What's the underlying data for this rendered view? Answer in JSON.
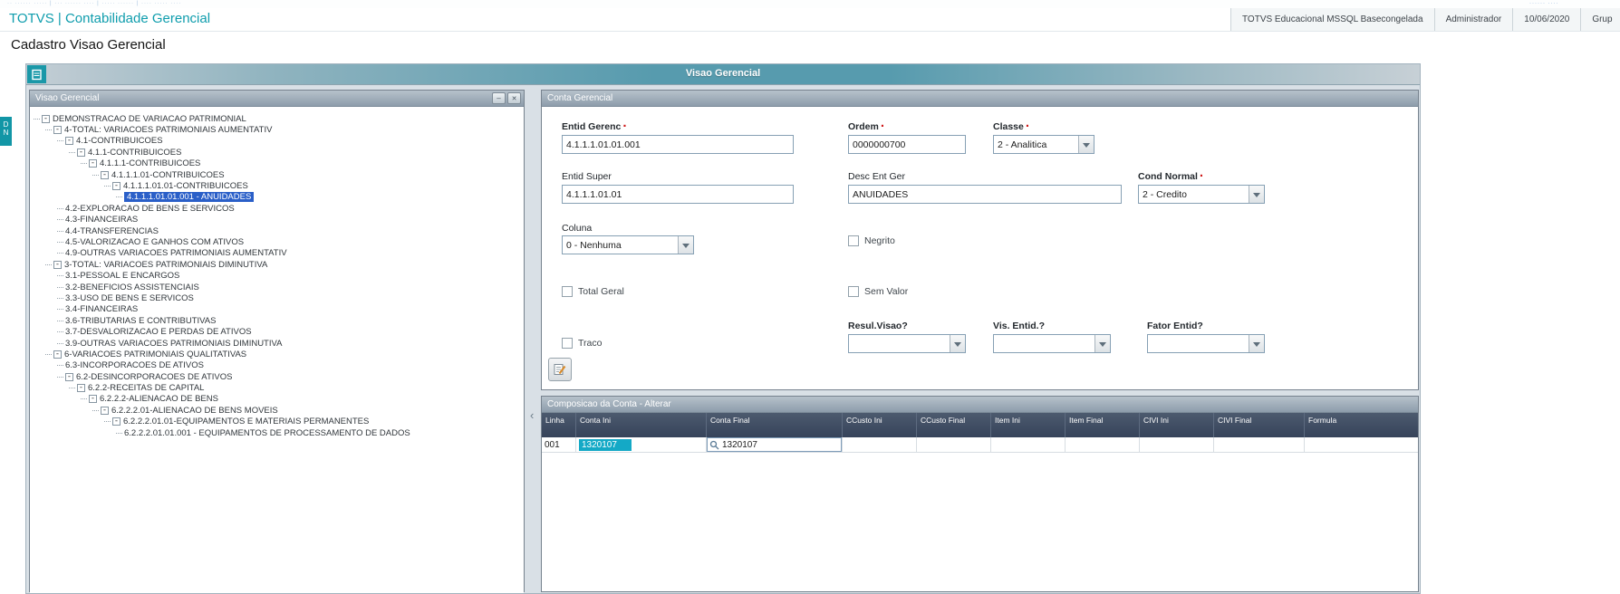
{
  "top_strip": {
    "left": "·· ······ ····· | ··· ······ ···· | ····· ······ | ···· ····· ····",
    "right": "······ ····"
  },
  "app_header": {
    "brand": "TOTVS | Contabilidade Gerencial",
    "environment": "TOTVS Educacional MSSQL Basecongelada",
    "user": "Administrador",
    "date": "10/06/2020",
    "group": "Grup"
  },
  "page_title": "Cadastro Visao Gerencial",
  "window": {
    "title": "Visao Gerencial"
  },
  "side_tab": "D\nN",
  "colors": {
    "brand_teal": "#0f9dad",
    "tree_selection": "#2a5fc8",
    "cell_highlight": "#14a9c6"
  },
  "tree_panel": {
    "title": "Visao Gerencial",
    "items": [
      {
        "level": 0,
        "label": "DEMONSTRACAO DE VARIACAO PATRIMONIAL",
        "expandable": true,
        "selected": false
      },
      {
        "level": 1,
        "label": "4-TOTAL: VARIACOES PATRIMONIAIS AUMENTATIV",
        "expandable": true,
        "selected": false
      },
      {
        "level": 2,
        "label": "4.1-CONTRIBUICOES",
        "expandable": true,
        "selected": false
      },
      {
        "level": 3,
        "label": "4.1.1-CONTRIBUICOES",
        "expandable": true,
        "selected": false
      },
      {
        "level": 4,
        "label": "4.1.1.1-CONTRIBUICOES",
        "expandable": true,
        "selected": false
      },
      {
        "level": 5,
        "label": "4.1.1.1.01-CONTRIBUICOES",
        "expandable": true,
        "selected": false
      },
      {
        "level": 6,
        "label": "4.1.1.1.01.01-CONTRIBUICOES",
        "expandable": true,
        "selected": false
      },
      {
        "level": 7,
        "label": "4.1.1.1.01.01.001 - ANUIDADES",
        "expandable": false,
        "selected": true
      },
      {
        "level": 2,
        "label": "4.2-EXPLORACAO DE BENS E SERVICOS",
        "expandable": false,
        "selected": false
      },
      {
        "level": 2,
        "label": "4.3-FINANCEIRAS",
        "expandable": false,
        "selected": false
      },
      {
        "level": 2,
        "label": "4.4-TRANSFERENCIAS",
        "expandable": false,
        "selected": false
      },
      {
        "level": 2,
        "label": "4.5-VALORIZACAO E GANHOS COM ATIVOS",
        "expandable": false,
        "selected": false
      },
      {
        "level": 2,
        "label": "4.9-OUTRAS VARIACOES PATRIMONIAIS AUMENTATIV",
        "expandable": false,
        "selected": false
      },
      {
        "level": 1,
        "label": "3-TOTAL: VARIACOES PATRIMONIAIS DIMINUTIVA",
        "expandable": true,
        "selected": false
      },
      {
        "level": 2,
        "label": "3.1-PESSOAL E ENCARGOS",
        "expandable": false,
        "selected": false
      },
      {
        "level": 2,
        "label": "3.2-BENEFICIOS ASSISTENCIAIS",
        "expandable": false,
        "selected": false
      },
      {
        "level": 2,
        "label": "3.3-USO DE BENS E SERVICOS",
        "expandable": false,
        "selected": false
      },
      {
        "level": 2,
        "label": "3.4-FINANCEIRAS",
        "expandable": false,
        "selected": false
      },
      {
        "level": 2,
        "label": "3.6-TRIBUTARIAS E CONTRIBUTIVAS",
        "expandable": false,
        "selected": false
      },
      {
        "level": 2,
        "label": "3.7-DESVALORIZACAO E PERDAS DE ATIVOS",
        "expandable": false,
        "selected": false
      },
      {
        "level": 2,
        "label": "3.9-OUTRAS VARIACOES PATRIMONIAIS DIMINUTIVA",
        "expandable": false,
        "selected": false
      },
      {
        "level": 1,
        "label": "6-VARIACOES PATRIMONIAIS QUALITATIVAS",
        "expandable": true,
        "selected": false
      },
      {
        "level": 2,
        "label": "6.3-INCORPORACOES DE ATIVOS",
        "expandable": false,
        "selected": false
      },
      {
        "level": 2,
        "label": "6.2-DESINCORPORACOES DE ATIVOS",
        "expandable": true,
        "selected": false
      },
      {
        "level": 3,
        "label": "6.2.2-RECEITAS DE CAPITAL",
        "expandable": true,
        "selected": false
      },
      {
        "level": 4,
        "label": "6.2.2.2-ALIENACAO DE BENS",
        "expandable": true,
        "selected": false
      },
      {
        "level": 5,
        "label": "6.2.2.2.01-ALIENACAO DE BENS MOVEIS",
        "expandable": true,
        "selected": false
      },
      {
        "level": 6,
        "label": "6.2.2.2.01.01-EQUIPAMENTOS E MATERIAIS PERMANENTES",
        "expandable": true,
        "selected": false
      },
      {
        "level": 7,
        "label": "6.2.2.2.01.01.001 - EQUIPAMENTOS DE PROCESSAMENTO DE DADOS",
        "expandable": false,
        "selected": false
      }
    ]
  },
  "form_panel": {
    "title": "Conta Gerencial",
    "fields": {
      "entid_gerenc": {
        "label": "Entid Gerenc",
        "required": true,
        "value": "4.1.1.1.01.01.001"
      },
      "ordem": {
        "label": "Ordem",
        "required": true,
        "value": "0000000700"
      },
      "classe": {
        "label": "Classe",
        "required": true,
        "value": "2 - Analitica"
      },
      "entid_super": {
        "label": "Entid Super",
        "required": false,
        "value": "4.1.1.1.01.01"
      },
      "desc_ent_ger": {
        "label": "Desc Ent Ger",
        "required": false,
        "value": "ANUIDADES"
      },
      "cond_normal": {
        "label": "Cond Normal",
        "required": true,
        "value": "2 - Credito"
      },
      "coluna": {
        "label": "Coluna",
        "required": false,
        "value": "0 - Nenhuma"
      },
      "negrito": {
        "label": "Negrito",
        "checked": false
      },
      "total_geral": {
        "label": "Total Geral",
        "checked": false
      },
      "sem_valor": {
        "label": "Sem Valor",
        "checked": false
      },
      "traco": {
        "label": "Traco",
        "checked": false
      },
      "resul_visao": {
        "label": "Resul.Visao?",
        "required": false,
        "value": ""
      },
      "vis_entid": {
        "label": "Vis. Entid.?",
        "required": false,
        "value": ""
      },
      "fator_entid": {
        "label": "Fator Entid?",
        "required": false,
        "value": ""
      }
    }
  },
  "grid_panel": {
    "title": "Composicao da Conta - Alterar",
    "columns": [
      "Linha",
      "Conta Ini",
      "Conta Final",
      "CCusto Ini",
      "CCusto Final",
      "Item Ini",
      "Item Final",
      "CIVI Ini",
      "CIVI Final",
      "Formula"
    ],
    "rows": [
      {
        "linha": "001",
        "conta_ini": "1320107",
        "conta_final": "1320107"
      }
    ]
  }
}
